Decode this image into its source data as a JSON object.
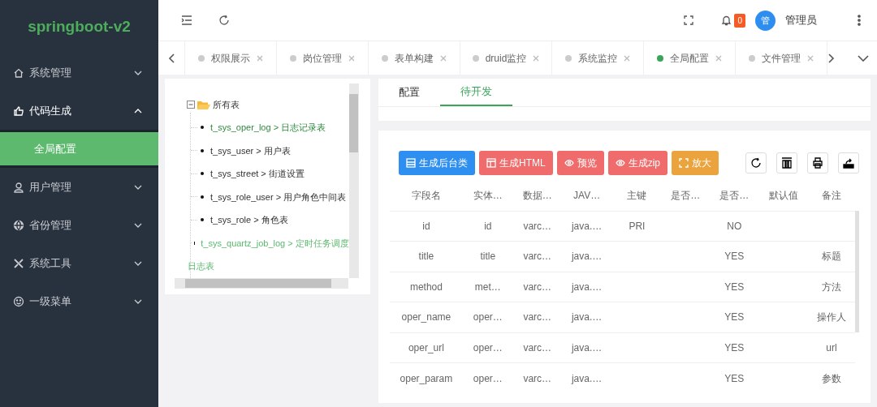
{
  "sidebar": {
    "logo": "springboot-v2",
    "items": [
      {
        "label": "系统管理",
        "expanded": false
      },
      {
        "label": "代码生成",
        "expanded": true,
        "children": [
          {
            "label": "全局配置",
            "selected": true
          }
        ]
      },
      {
        "label": "用户管理",
        "expanded": false
      },
      {
        "label": "省份管理",
        "expanded": false
      },
      {
        "label": "系统工具",
        "expanded": false
      },
      {
        "label": "一级菜单",
        "expanded": false
      }
    ]
  },
  "header": {
    "notification_count": "0",
    "avatar_text": "管",
    "user_name": "管理员"
  },
  "tabs": [
    {
      "label": "权限展示",
      "selected": false
    },
    {
      "label": "岗位管理",
      "selected": false
    },
    {
      "label": "表单构建",
      "selected": false
    },
    {
      "label": "druid监控",
      "selected": false
    },
    {
      "label": "系统监控",
      "selected": false
    },
    {
      "label": "全局配置",
      "selected": true
    },
    {
      "label": "文件管理",
      "selected": false
    }
  ],
  "tree": {
    "root": {
      "label": "所有表",
      "expanded": true,
      "children": [
        {
          "lines": [
            "t_sys_oper_log > 日志记录表"
          ],
          "selected": true,
          "hovered": false
        },
        {
          "lines": [
            "t_sys_user > 用户表"
          ],
          "selected": false,
          "hovered": false
        },
        {
          "lines": [
            "t_sys_street > 街道设置"
          ],
          "selected": false,
          "hovered": false
        },
        {
          "lines": [
            "t_sys_role_user > 用户角色中间表"
          ],
          "selected": false,
          "hovered": false
        },
        {
          "lines": [
            "t_sys_role > 角色表"
          ],
          "selected": false,
          "hovered": false
        },
        {
          "lines": [
            "t_sys_quartz_job_log > 定时任务调度",
            "日志表"
          ],
          "selected": false,
          "hovered": true
        }
      ]
    }
  },
  "subtabs": [
    {
      "label": "配置",
      "selected": false
    },
    {
      "label": "待开发",
      "selected": true
    }
  ],
  "actions": [
    {
      "label": "生成后台类",
      "color": "#2f8ff0"
    },
    {
      "label": "生成HTML",
      "color": "#f06b6b"
    },
    {
      "label": "预览",
      "color": "#f06b6b"
    },
    {
      "label": "生成zip",
      "color": "#f06b6b"
    },
    {
      "label": "放大",
      "color": "#eba33d"
    }
  ],
  "table": {
    "columns": [
      "字段名",
      "实体…",
      "数据…",
      "JAV…",
      "主键",
      "是否…",
      "是否…",
      "默认值",
      "备注"
    ],
    "rows": [
      [
        "id",
        "id",
        "varc…",
        "java.…",
        "PRI",
        "",
        "NO",
        "",
        ""
      ],
      [
        "title",
        "title",
        "varc…",
        "java.…",
        "",
        "",
        "YES",
        "",
        "标题"
      ],
      [
        "method",
        "met…",
        "varc…",
        "java.…",
        "",
        "",
        "YES",
        "",
        "方法"
      ],
      [
        "oper_name",
        "oper…",
        "varc…",
        "java.…",
        "",
        "",
        "YES",
        "",
        "操作人"
      ],
      [
        "oper_url",
        "oper…",
        "varc…",
        "java.…",
        "",
        "",
        "YES",
        "",
        "url"
      ],
      [
        "oper_param",
        "oper…",
        "varc…",
        "java.…",
        "",
        "",
        "YES",
        "",
        "参数"
      ]
    ]
  }
}
